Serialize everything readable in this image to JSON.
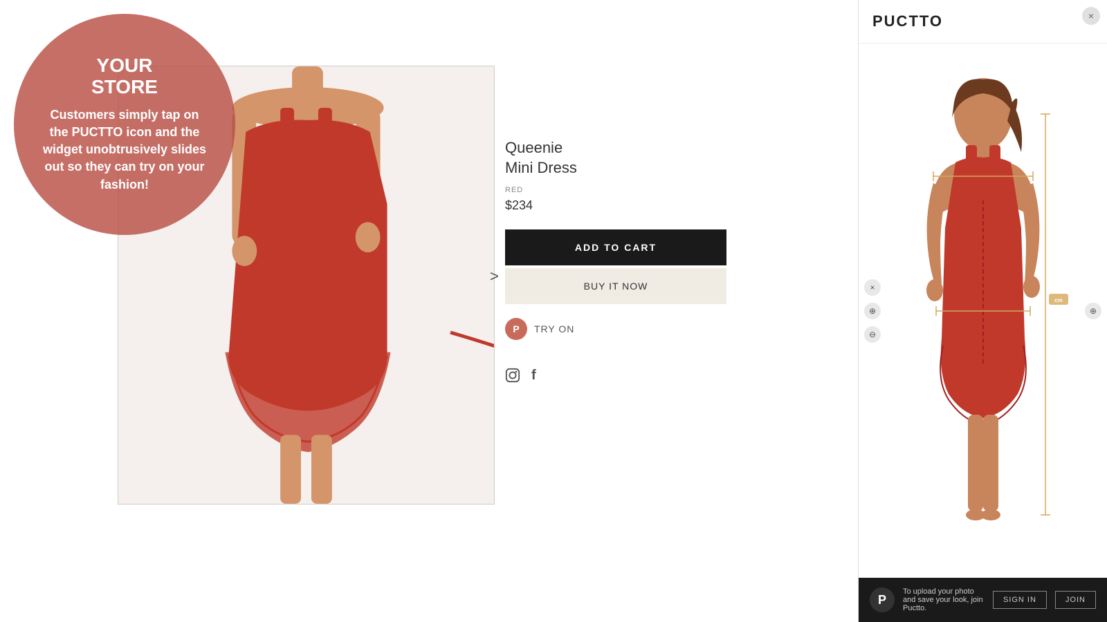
{
  "store": {
    "label_line1": "YOUR",
    "label_line2": "STORE"
  },
  "callout": {
    "text": "Customers simply tap on the PUCTTO icon and the widget unobtrusively slides out so they can try on your fashion!"
  },
  "product": {
    "name_line1": "Queenie",
    "name_line2": "Mini Dress",
    "color": "RED",
    "price": "$234",
    "add_to_cart_label": "ADD TO CART",
    "buy_now_label": "BUY IT NOW",
    "try_on_label": "TRY ON"
  },
  "puctto": {
    "logo": "PUCTTO",
    "footer_text": "To upload your photo and save your look, join Puctto.",
    "sign_in_label": "SIGN IN",
    "join_label": "JOIN"
  },
  "icons": {
    "close": "×",
    "next_arrow": ">",
    "instagram": "📷",
    "facebook": "f",
    "puctto_p": "P"
  },
  "colors": {
    "dress_red": "#c0392b",
    "circle_bg": "rgba(185,79,70,0.82)",
    "dark_btn": "#1a1a1a",
    "light_btn": "#f0ece4",
    "puctto_accent": "#c96b5a"
  }
}
